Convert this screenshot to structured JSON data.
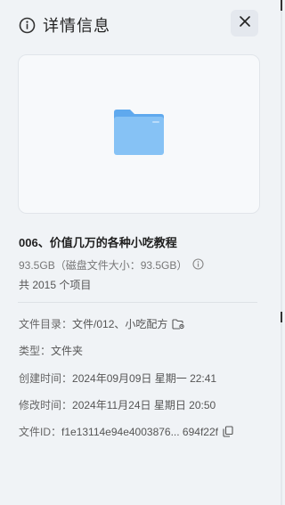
{
  "header": {
    "title": "详情信息",
    "close_icon": "close-icon",
    "info_icon": "info-icon"
  },
  "preview": {
    "icon": "folder-icon",
    "colors": {
      "folder_front": "#86c2f5",
      "folder_back": "#5fa9ee"
    }
  },
  "file": {
    "name": "006、价值几万的各种小吃教程",
    "size_text": "93.5GB（磁盘文件大小：93.5GB）",
    "item_count": "共 2015 个项目"
  },
  "details": {
    "path_label": "文件目录：",
    "path_value": "文件/012、小吃配方",
    "type_label": "类型：",
    "type_value": "文件夹",
    "created_label": "创建时间：",
    "created_value": "2024年09月09日 星期一 22:41",
    "modified_label": "修改时间：",
    "modified_value": "2024年11月24日 星期日 20:50",
    "fileid_label": "文件ID：",
    "fileid_value": "f1e13114e94e4003876... 694f22f"
  }
}
